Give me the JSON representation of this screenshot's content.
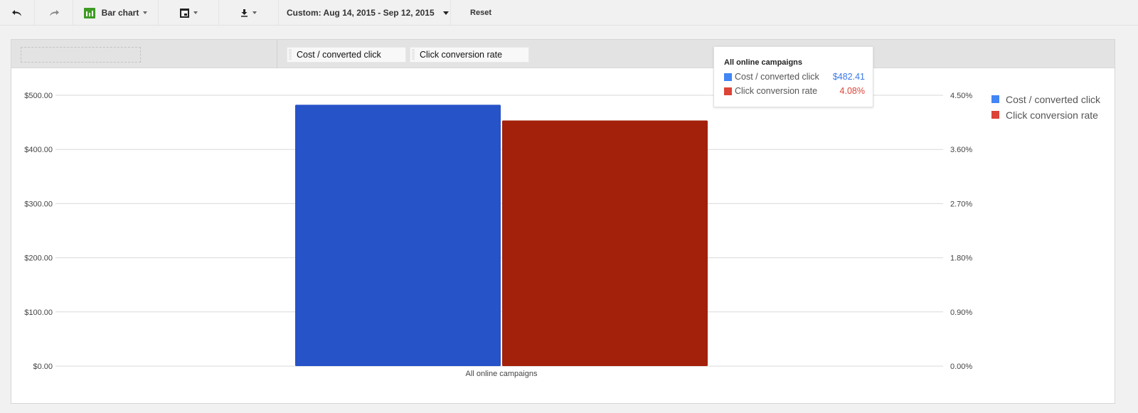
{
  "toolbar": {
    "undo_icon": "undo-icon",
    "redo_icon": "redo-icon",
    "chart_type_label": "Bar chart",
    "chart_type_icon": "bar-chart-icon",
    "calendar_icon": "calendar-icon",
    "download_icon": "download-icon",
    "date_range_label": "Custom: Aug 14, 2015 - Sep 12, 2015",
    "reset_label": "Reset"
  },
  "panel": {
    "metric_chips": [
      "Cost / converted click",
      "Click conversion rate"
    ]
  },
  "tooltip": {
    "title": "All online campaigns",
    "rows": [
      {
        "label": "Cost / converted click",
        "value": "$482.41",
        "color": "#4285f4",
        "value_color": "#3b78e7"
      },
      {
        "label": "Click conversion rate",
        "value": "4.08%",
        "value_color": "#db4437",
        "color": "#db4437"
      }
    ]
  },
  "chart_data": {
    "type": "bar",
    "title": "",
    "categories": [
      "All online campaigns"
    ],
    "series": [
      {
        "name": "Cost / converted click",
        "values": [
          482.41
        ],
        "axis": "left",
        "color": "#2753c9",
        "legend_color": "#4285f4"
      },
      {
        "name": "Click conversion rate",
        "values": [
          4.08
        ],
        "axis": "right",
        "color": "#a3210b",
        "legend_color": "#db4437"
      }
    ],
    "xlabel": "",
    "ylabel_left": "",
    "ylabel_right": "",
    "ylim_left": [
      0,
      500
    ],
    "ylim_right": [
      0,
      4.5
    ],
    "yticks_left": [
      "$0.00",
      "$100.00",
      "$200.00",
      "$300.00",
      "$400.00",
      "$500.00"
    ],
    "yticks_right": [
      "0.00%",
      "0.90%",
      "1.80%",
      "2.70%",
      "3.60%",
      "4.50%"
    ],
    "grid": true,
    "legend_position": "right",
    "legend": [
      "Cost / converted click",
      "Click conversion rate"
    ]
  }
}
